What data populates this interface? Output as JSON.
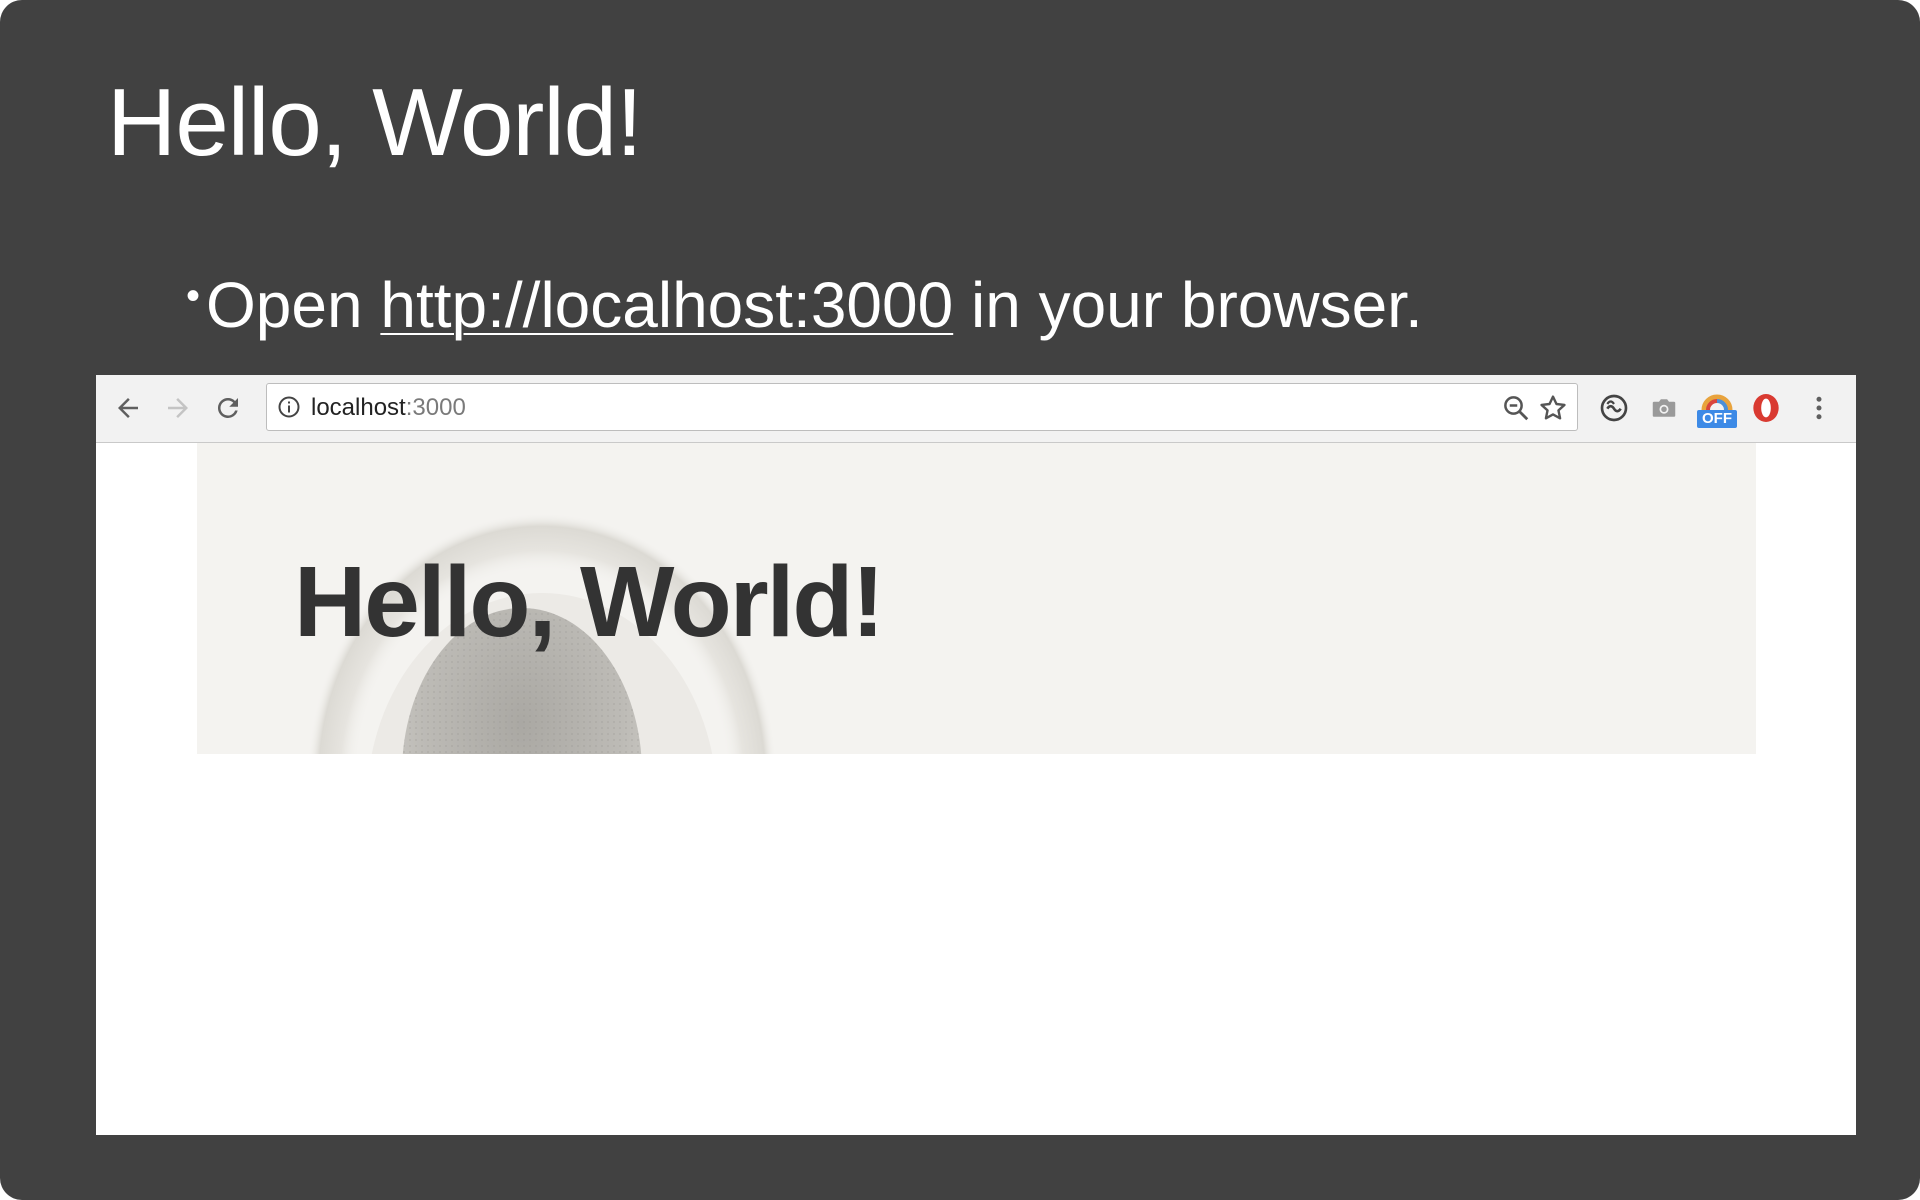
{
  "slide": {
    "title": "Hello, World!",
    "bullet": {
      "marker": "•",
      "prefix": "Open ",
      "link": "http://localhost:3000",
      "suffix": " in your browser."
    }
  },
  "browser": {
    "toolbar": {
      "icons": {
        "back": "arrow-left-icon",
        "forward": "arrow-right-icon",
        "reload": "reload-icon",
        "info": "info-icon",
        "zoom": "zoom-out-icon",
        "bookmark": "star-icon",
        "sync": "sync-icon",
        "camera": "camera-icon",
        "extension_off": "extension-off-icon",
        "opera": "opera-icon",
        "menu": "more-vertical-icon"
      },
      "extension_badge": "OFF"
    },
    "address_bar": {
      "host": "localhost",
      "port": ":3000"
    },
    "page": {
      "heading": "Hello, World!"
    }
  },
  "colors": {
    "slide_background": "#414141",
    "slide_text": "#ffffff",
    "toolbar_background": "#f2f2f2",
    "hero_background": "#f4f3f0",
    "hero_heading": "#333333",
    "opera_red": "#d93a31",
    "badge_blue": "#3d8ae6"
  }
}
